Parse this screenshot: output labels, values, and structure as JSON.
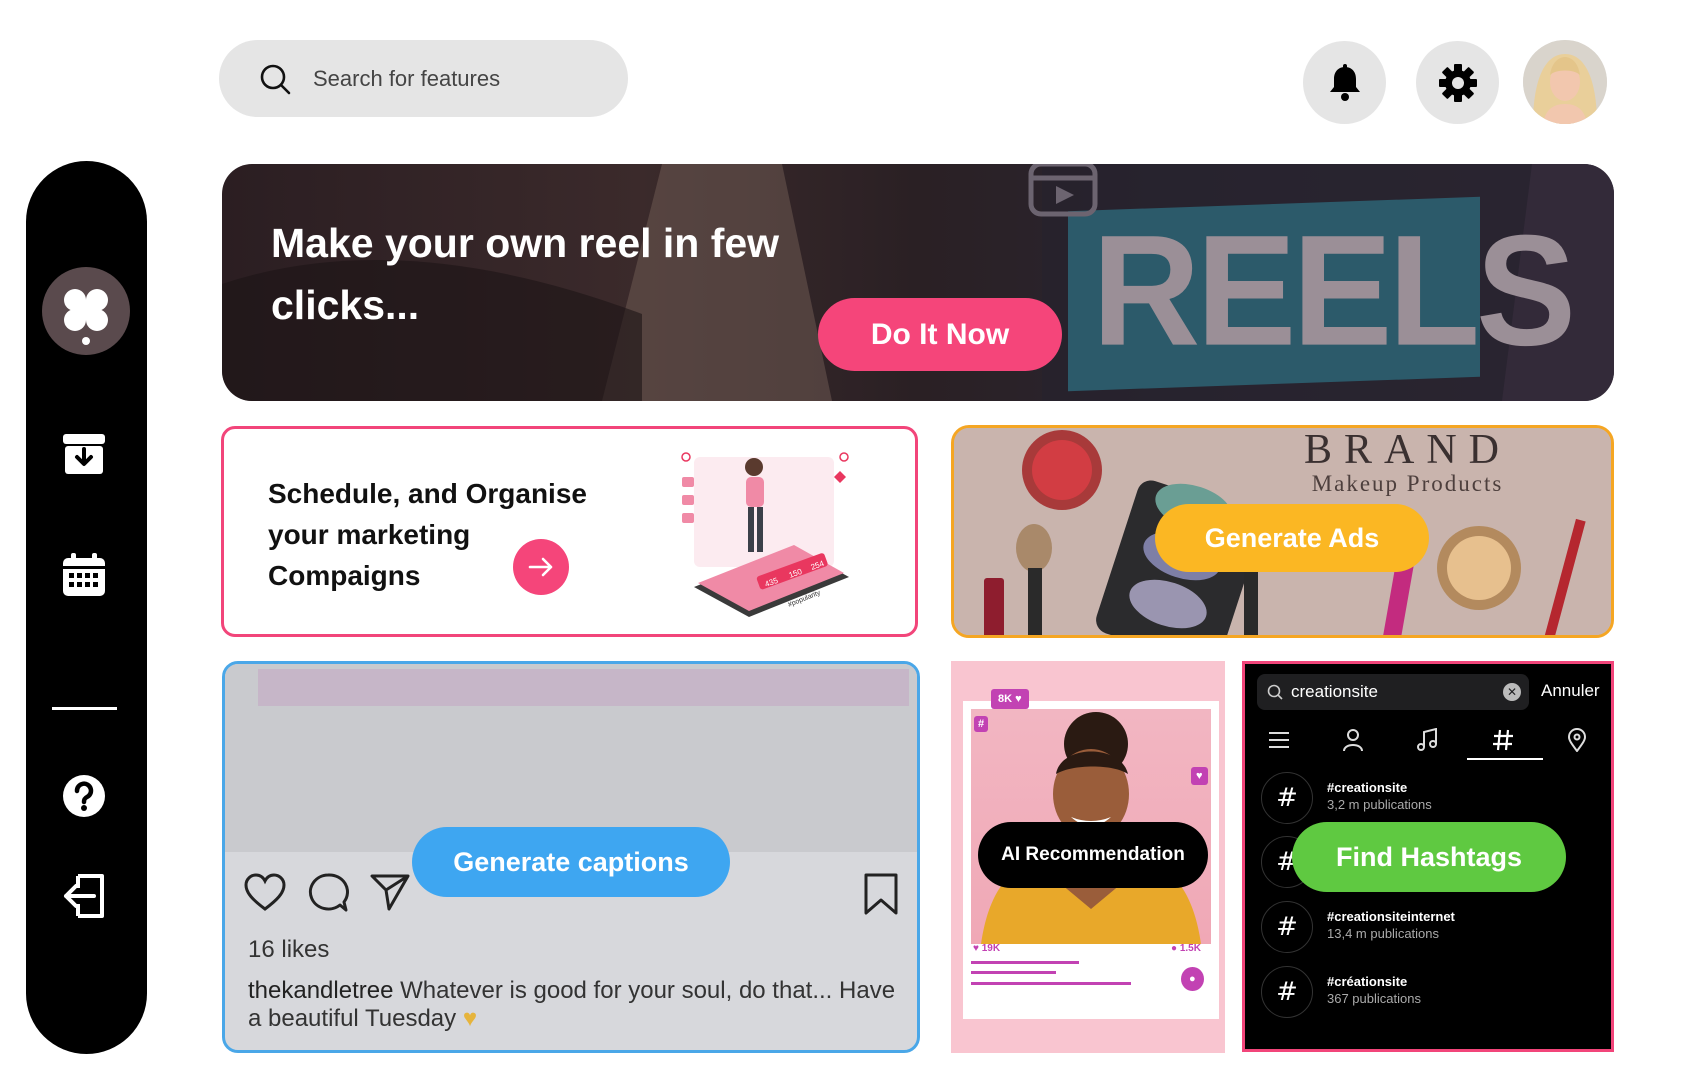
{
  "search": {
    "placeholder": "Search for features"
  },
  "header": {
    "notifications_icon": "bell-icon",
    "settings_icon": "gear-icon"
  },
  "sidebar": {
    "items": [
      {
        "name": "dashboard",
        "icon": "clover-icon"
      },
      {
        "name": "archive",
        "icon": "archive-download-icon"
      },
      {
        "name": "calendar",
        "icon": "calendar-icon"
      },
      {
        "name": "help",
        "icon": "question-icon"
      },
      {
        "name": "logout",
        "icon": "logout-icon"
      }
    ]
  },
  "hero": {
    "title": "Make your own reel in few clicks...",
    "button": "Do It Now",
    "reels_word": "REELS"
  },
  "schedule": {
    "title": "Schedule, and Organise your marketing Compaigns",
    "illustration_tags": [
      "435",
      "150",
      "254",
      "#popularity"
    ]
  },
  "brand": {
    "title": "BRAND",
    "subtitle": "Makeup Products",
    "button": "Generate Ads"
  },
  "caption": {
    "button": "Generate captions",
    "likes": "16 likes",
    "username": "thekandletree",
    "text": " Whatever is good for your soul, do that... Have a beautiful Tuesday"
  },
  "ai": {
    "button": "AI Recommendation",
    "badge_likes": "8K",
    "stat_left": "19K",
    "stat_right": "1.5K"
  },
  "hashtags": {
    "search_value": "creationsite",
    "cancel": "Annuler",
    "button": "Find Hashtags",
    "results": [
      {
        "name": "#creationsite",
        "count": "3,2 m publications"
      },
      {
        "name": "#creationsiteinternet",
        "count": "13,4 m publications"
      },
      {
        "name": "#créationsite",
        "count": "367 publications"
      }
    ]
  },
  "colors": {
    "pink": "#f5457a",
    "yellow": "#fbb723",
    "blue": "#3ea6f1",
    "green": "#5fc941"
  }
}
